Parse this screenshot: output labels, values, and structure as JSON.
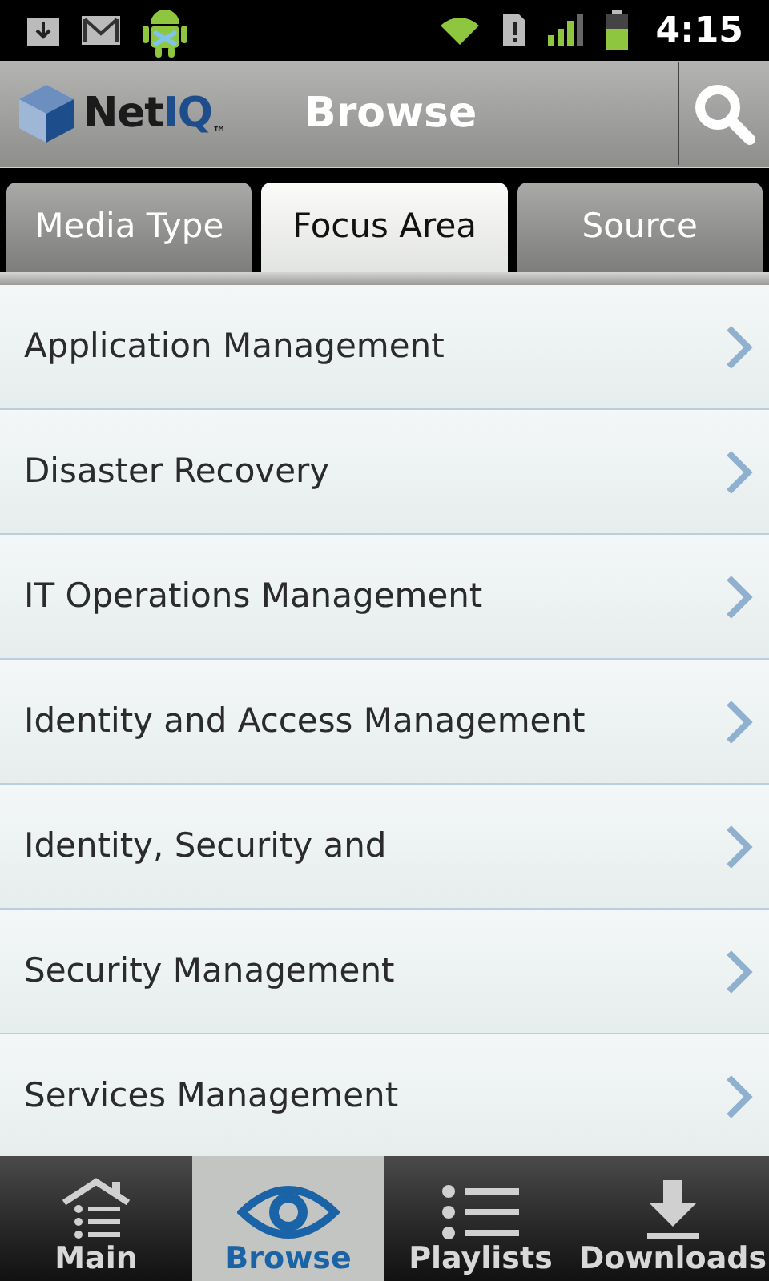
{
  "status_bar": {
    "time": "4:15"
  },
  "header": {
    "logo": {
      "name": "Net",
      "accent": "IQ",
      "mark": "™"
    },
    "title": "Browse"
  },
  "tabs": [
    {
      "label": "Media Type",
      "selected": false
    },
    {
      "label": "Focus Area",
      "selected": true
    },
    {
      "label": "Source",
      "selected": false
    }
  ],
  "items": [
    {
      "label": "Application Management"
    },
    {
      "label": "Disaster Recovery"
    },
    {
      "label": "IT Operations Management"
    },
    {
      "label": "Identity and Access Management"
    },
    {
      "label": "Identity, Security and"
    },
    {
      "label": "Security Management"
    },
    {
      "label": "Services Management"
    }
  ],
  "bottom_nav": [
    {
      "label": "Main",
      "kind": "home",
      "selected": false
    },
    {
      "label": "Browse",
      "kind": "eye",
      "selected": true
    },
    {
      "label": "Playlists",
      "kind": "list",
      "selected": false
    },
    {
      "label": "Downloads",
      "kind": "download",
      "selected": false
    }
  ]
}
